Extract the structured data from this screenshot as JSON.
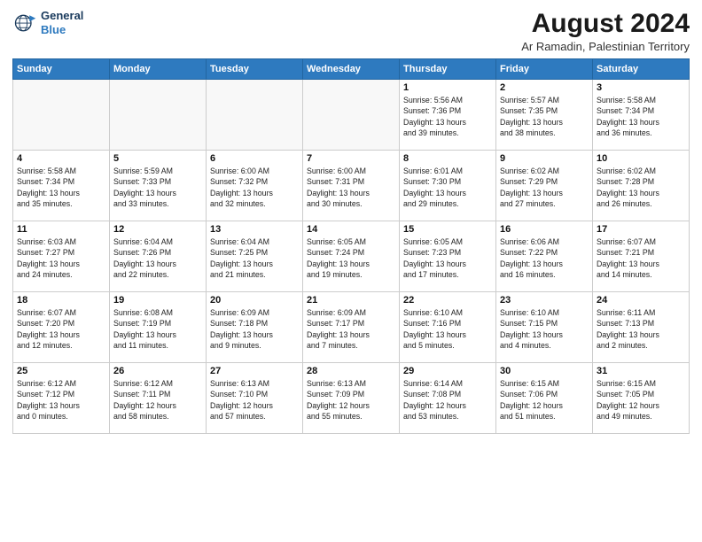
{
  "header": {
    "logo_line1": "General",
    "logo_line2": "Blue",
    "main_title": "August 2024",
    "subtitle": "Ar Ramadin, Palestinian Territory"
  },
  "calendar": {
    "days_of_week": [
      "Sunday",
      "Monday",
      "Tuesday",
      "Wednesday",
      "Thursday",
      "Friday",
      "Saturday"
    ],
    "weeks": [
      [
        {
          "day": "",
          "info": ""
        },
        {
          "day": "",
          "info": ""
        },
        {
          "day": "",
          "info": ""
        },
        {
          "day": "",
          "info": ""
        },
        {
          "day": "1",
          "info": "Sunrise: 5:56 AM\nSunset: 7:36 PM\nDaylight: 13 hours\nand 39 minutes."
        },
        {
          "day": "2",
          "info": "Sunrise: 5:57 AM\nSunset: 7:35 PM\nDaylight: 13 hours\nand 38 minutes."
        },
        {
          "day": "3",
          "info": "Sunrise: 5:58 AM\nSunset: 7:34 PM\nDaylight: 13 hours\nand 36 minutes."
        }
      ],
      [
        {
          "day": "4",
          "info": "Sunrise: 5:58 AM\nSunset: 7:34 PM\nDaylight: 13 hours\nand 35 minutes."
        },
        {
          "day": "5",
          "info": "Sunrise: 5:59 AM\nSunset: 7:33 PM\nDaylight: 13 hours\nand 33 minutes."
        },
        {
          "day": "6",
          "info": "Sunrise: 6:00 AM\nSunset: 7:32 PM\nDaylight: 13 hours\nand 32 minutes."
        },
        {
          "day": "7",
          "info": "Sunrise: 6:00 AM\nSunset: 7:31 PM\nDaylight: 13 hours\nand 30 minutes."
        },
        {
          "day": "8",
          "info": "Sunrise: 6:01 AM\nSunset: 7:30 PM\nDaylight: 13 hours\nand 29 minutes."
        },
        {
          "day": "9",
          "info": "Sunrise: 6:02 AM\nSunset: 7:29 PM\nDaylight: 13 hours\nand 27 minutes."
        },
        {
          "day": "10",
          "info": "Sunrise: 6:02 AM\nSunset: 7:28 PM\nDaylight: 13 hours\nand 26 minutes."
        }
      ],
      [
        {
          "day": "11",
          "info": "Sunrise: 6:03 AM\nSunset: 7:27 PM\nDaylight: 13 hours\nand 24 minutes."
        },
        {
          "day": "12",
          "info": "Sunrise: 6:04 AM\nSunset: 7:26 PM\nDaylight: 13 hours\nand 22 minutes."
        },
        {
          "day": "13",
          "info": "Sunrise: 6:04 AM\nSunset: 7:25 PM\nDaylight: 13 hours\nand 21 minutes."
        },
        {
          "day": "14",
          "info": "Sunrise: 6:05 AM\nSunset: 7:24 PM\nDaylight: 13 hours\nand 19 minutes."
        },
        {
          "day": "15",
          "info": "Sunrise: 6:05 AM\nSunset: 7:23 PM\nDaylight: 13 hours\nand 17 minutes."
        },
        {
          "day": "16",
          "info": "Sunrise: 6:06 AM\nSunset: 7:22 PM\nDaylight: 13 hours\nand 16 minutes."
        },
        {
          "day": "17",
          "info": "Sunrise: 6:07 AM\nSunset: 7:21 PM\nDaylight: 13 hours\nand 14 minutes."
        }
      ],
      [
        {
          "day": "18",
          "info": "Sunrise: 6:07 AM\nSunset: 7:20 PM\nDaylight: 13 hours\nand 12 minutes."
        },
        {
          "day": "19",
          "info": "Sunrise: 6:08 AM\nSunset: 7:19 PM\nDaylight: 13 hours\nand 11 minutes."
        },
        {
          "day": "20",
          "info": "Sunrise: 6:09 AM\nSunset: 7:18 PM\nDaylight: 13 hours\nand 9 minutes."
        },
        {
          "day": "21",
          "info": "Sunrise: 6:09 AM\nSunset: 7:17 PM\nDaylight: 13 hours\nand 7 minutes."
        },
        {
          "day": "22",
          "info": "Sunrise: 6:10 AM\nSunset: 7:16 PM\nDaylight: 13 hours\nand 5 minutes."
        },
        {
          "day": "23",
          "info": "Sunrise: 6:10 AM\nSunset: 7:15 PM\nDaylight: 13 hours\nand 4 minutes."
        },
        {
          "day": "24",
          "info": "Sunrise: 6:11 AM\nSunset: 7:13 PM\nDaylight: 13 hours\nand 2 minutes."
        }
      ],
      [
        {
          "day": "25",
          "info": "Sunrise: 6:12 AM\nSunset: 7:12 PM\nDaylight: 13 hours\nand 0 minutes."
        },
        {
          "day": "26",
          "info": "Sunrise: 6:12 AM\nSunset: 7:11 PM\nDaylight: 12 hours\nand 58 minutes."
        },
        {
          "day": "27",
          "info": "Sunrise: 6:13 AM\nSunset: 7:10 PM\nDaylight: 12 hours\nand 57 minutes."
        },
        {
          "day": "28",
          "info": "Sunrise: 6:13 AM\nSunset: 7:09 PM\nDaylight: 12 hours\nand 55 minutes."
        },
        {
          "day": "29",
          "info": "Sunrise: 6:14 AM\nSunset: 7:08 PM\nDaylight: 12 hours\nand 53 minutes."
        },
        {
          "day": "30",
          "info": "Sunrise: 6:15 AM\nSunset: 7:06 PM\nDaylight: 12 hours\nand 51 minutes."
        },
        {
          "day": "31",
          "info": "Sunrise: 6:15 AM\nSunset: 7:05 PM\nDaylight: 12 hours\nand 49 minutes."
        }
      ]
    ]
  }
}
